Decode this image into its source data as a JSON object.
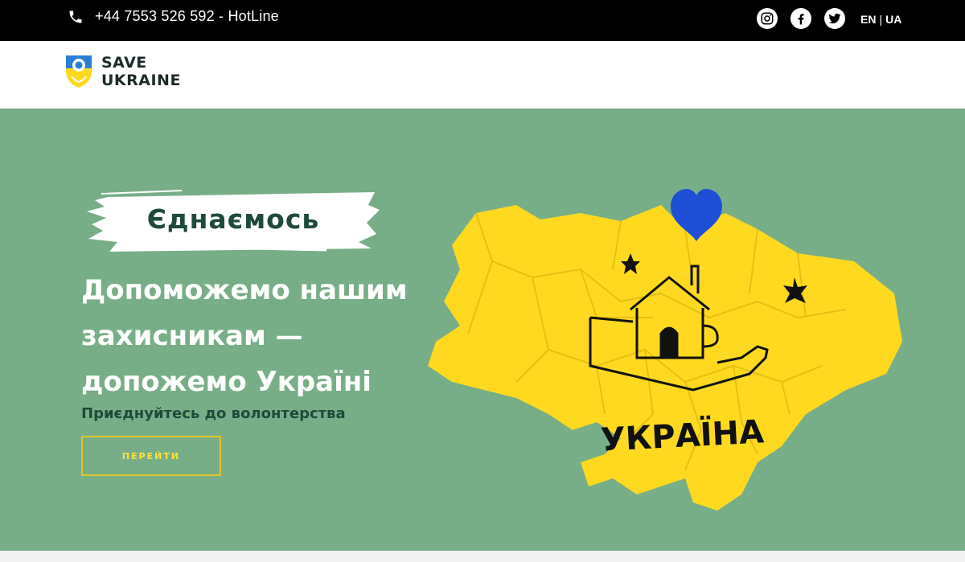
{
  "topbar": {
    "phone": "+44 7553 526 592 - HotLine",
    "socials": [
      {
        "name": "instagram"
      },
      {
        "name": "facebook"
      },
      {
        "name": "twitter"
      }
    ],
    "lang": {
      "en": "EN",
      "sep": "|",
      "ua": "UA"
    }
  },
  "header": {
    "logo_line1": "SAVE",
    "logo_line2": "UKRAINE"
  },
  "hero": {
    "tagline": "Єднаємось",
    "headline_line1": "Допоможемо нашим",
    "headline_line2": "захисникам —",
    "headline_line3": "допожемо Україні",
    "subtitle": "Приєднуйтесь до волонтерства",
    "cta_label": "ПЕРЕЙТИ",
    "map_label": "УКРАЇНА"
  },
  "colors": {
    "hero_bg": "#78ae87",
    "accent_yellow": "#ffd91f",
    "accent_blue": "#1f4fd6",
    "dark_green": "#1f4a3a"
  }
}
